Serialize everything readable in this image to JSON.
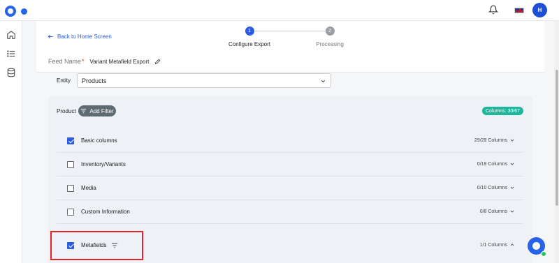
{
  "header": {
    "back_label": "Back to Home Screen",
    "steps": [
      {
        "number": "1",
        "label": "Configure Export"
      },
      {
        "number": "2",
        "label": "Processing"
      }
    ],
    "feed_name_label": "Feed Name",
    "feed_name_required": "*",
    "feed_name_value": "Variant Metafield Export"
  },
  "topbar": {
    "avatar_initial": "H"
  },
  "entity": {
    "label": "Entity",
    "selected": "Products"
  },
  "panel": {
    "product_label": "Product",
    "add_filter_label": "Add Filter",
    "columns_badge": "Columns: 30/67",
    "rows": [
      {
        "name": "Basic columns",
        "checked": true,
        "count": "29/29 Columns",
        "chevron": "down"
      },
      {
        "name": "Inventory/Variants",
        "checked": false,
        "count": "0/18 Columns",
        "chevron": "down"
      },
      {
        "name": "Media",
        "checked": false,
        "count": "0/10 Columns",
        "chevron": "down"
      },
      {
        "name": "Custom Information",
        "checked": false,
        "count": "0/8 Columns",
        "chevron": "down"
      },
      {
        "name": "Metafields",
        "checked": true,
        "count": "1/1 Columns",
        "chevron": "up"
      }
    ]
  },
  "colors": {
    "primary": "#2b5be0",
    "badge": "#20b69c",
    "highlight": "#e0232f"
  },
  "icons": [
    "bell-icon",
    "flag-uk-icon",
    "home-icon",
    "list-icon",
    "database-icon",
    "arrow-left-icon",
    "pencil-icon",
    "chevron-down-icon",
    "chevron-up-icon",
    "filter-icon",
    "chat-icon"
  ]
}
